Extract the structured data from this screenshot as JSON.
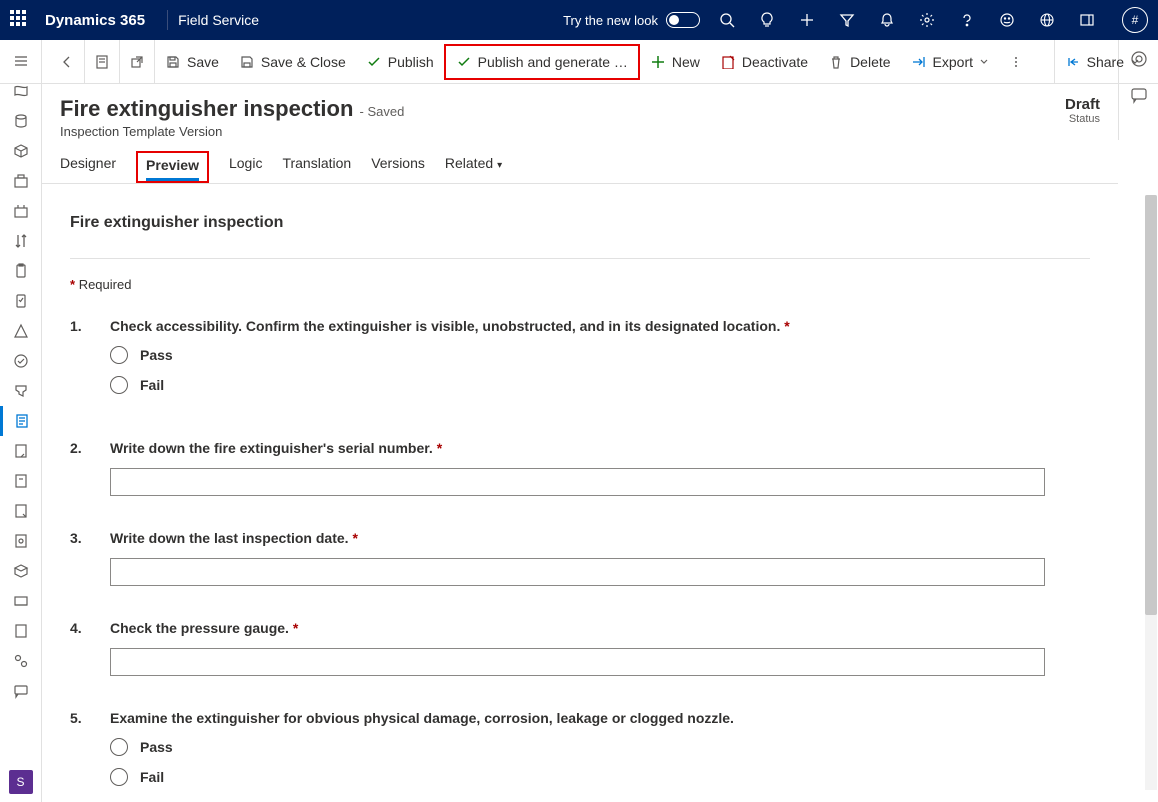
{
  "top": {
    "brand": "Dynamics 365",
    "app": "Field Service",
    "try_label": "Try the new look",
    "avatar_glyph": "#"
  },
  "cmd": {
    "save": "Save",
    "save_close": "Save & Close",
    "publish": "Publish",
    "publish_gen": "Publish and generate …",
    "new": "New",
    "deactivate": "Deactivate",
    "delete": "Delete",
    "export": "Export",
    "share": "Share"
  },
  "record": {
    "title": "Fire extinguisher inspection",
    "saved_suffix": "- Saved",
    "subtitle": "Inspection Template Version",
    "status_value": "Draft",
    "status_label": "Status"
  },
  "tabs": {
    "designer": "Designer",
    "preview": "Preview",
    "logic": "Logic",
    "translation": "Translation",
    "versions": "Versions",
    "related": "Related"
  },
  "preview": {
    "heading": "Fire extinguisher inspection",
    "required_label": "Required",
    "pass": "Pass",
    "fail": "Fail",
    "questions": {
      "q1": {
        "num": "1.",
        "text": "Check accessibility. Confirm the extinguisher is visible, unobstructed, and in its designated location.",
        "required": true,
        "type": "radio"
      },
      "q2": {
        "num": "2.",
        "text": "Write down the fire extinguisher's serial number.",
        "required": true,
        "type": "text"
      },
      "q3": {
        "num": "3.",
        "text": "Write down the last inspection date.",
        "required": true,
        "type": "text"
      },
      "q4": {
        "num": "4.",
        "text": "Check the pressure gauge.",
        "required": true,
        "type": "text"
      },
      "q5": {
        "num": "5.",
        "text": "Examine the extinguisher for obvious physical damage, corrosion, leakage or clogged nozzle.",
        "required": false,
        "type": "radio"
      }
    }
  }
}
